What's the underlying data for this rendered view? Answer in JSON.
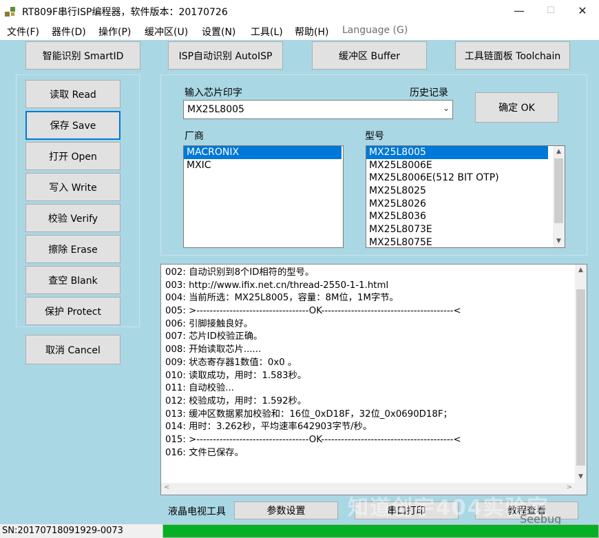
{
  "window": {
    "title": "RT809F串行ISP编程器，软件版本：20170726",
    "minimize": "—",
    "maximize": "☐",
    "close": "✕"
  },
  "menu": [
    "文件(F)",
    "器件(D)",
    "操作(P)",
    "缓冲区(U)",
    "设置(N)",
    "工具(L)",
    "帮助(H)",
    "Language (G)"
  ],
  "top_buttons": {
    "smartid": "智能识别 SmartID",
    "autoisp": "ISP自动识别 AutoISP",
    "buffer": "缓冲区 Buffer",
    "toolchain": "工具链面板 Toolchain"
  },
  "side_buttons": {
    "read": "读取 Read",
    "save": "保存 Save",
    "open": "打开 Open",
    "write": "写入 Write",
    "verify": "校验 Verify",
    "erase": "擦除 Erase",
    "blank": "查空 Blank",
    "protect": "保护 Protect",
    "cancel": "取消 Cancel"
  },
  "chip": {
    "input_label": "输入芯片印字",
    "history_label": "历史记录",
    "value": "MX25L8005",
    "ok": "确定 OK",
    "vendor_label": "厂商",
    "model_label": "型号"
  },
  "vendors": [
    "MACRONIX",
    "MXIC"
  ],
  "models": [
    "MX25L8005",
    "MX25L8006E",
    "MX25L8006E(512 BIT OTP)",
    "MX25L8025",
    "MX25L8026",
    "MX25L8036",
    "MX25L8073E",
    "MX25L8075E"
  ],
  "log": [
    "002: 自动识别到8个ID相符的型号。",
    "003: http://www.ifix.net.cn/thread-2550-1-1.html",
    "004: 当前所选：MX25L8005，容量：8M位，1M字节。",
    "005: >----------------------------------OK----------------------------------------<",
    "006: 引脚接触良好。",
    "007: 芯片ID校验正确。",
    "008: 开始读取芯片......",
    "009: 状态寄存器1数值：0x0 。",
    "010: 读取成功，用时：1.583秒。",
    "011: 自动校验...",
    "012: 校验成功，用时：1.592秒。",
    "013: 缓冲区数据累加校验和：16位_0xD18F，32位_0x0690D18F；",
    "014: 用时：3.262秒，平均速率642903字节/秒。",
    "015: >----------------------------------OK----------------------------------------<",
    "016: 文件已保存。"
  ],
  "bottom": {
    "tv_tools": "液晶电视工具",
    "params": "参数设置",
    "serial": "串口打印",
    "tutorial": "教程查看"
  },
  "status": {
    "sn": "SN:20170718091929-0073",
    "progress": 1.0
  },
  "watermark": {
    "text": "知道创宇404实验室",
    "brand": "Seebug"
  },
  "colors": {
    "client_bg": "#aad7e4",
    "selection": "#0078d7",
    "progress": "#06b025"
  }
}
